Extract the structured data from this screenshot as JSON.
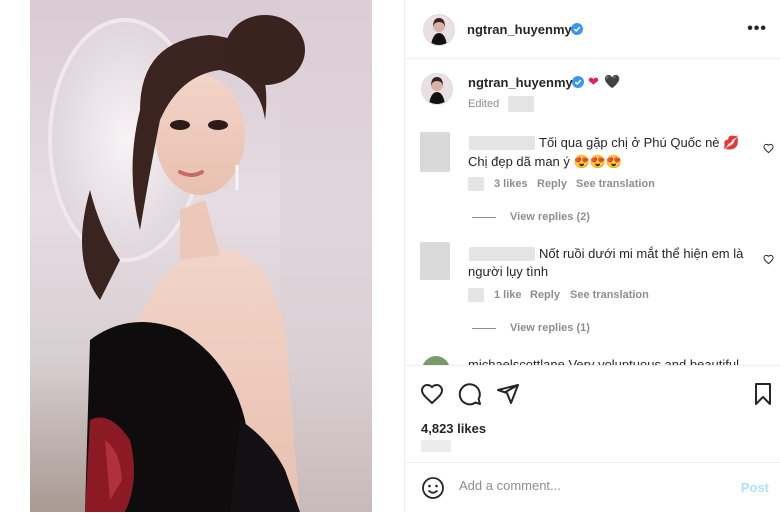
{
  "post": {
    "author": "ngtran_huyenmy",
    "caption_emojis": [
      "❤",
      "🖤"
    ],
    "edited_label": "Edited",
    "likes": "4,823 likes"
  },
  "comments": [
    {
      "line1": "Tối qua gặp chị ở Phú Quốc nè 💋",
      "line2": "Chị đẹp dã man ý 😍😍😍",
      "likes": "3 likes",
      "reply": "Reply",
      "translate": "See translation",
      "view_replies": "View replies (2)"
    },
    {
      "line1": "Nốt ruồi dưới mi mắt thể hiện em là",
      "line2": "người lụy tình",
      "likes": "1 like",
      "reply": "Reply",
      "translate": "See translation",
      "view_replies": "View replies (1)"
    }
  ],
  "partial_comment": "michaelscottlane Very voluptuous and beautiful",
  "add_comment": {
    "placeholder": "Add a comment...",
    "post_label": "Post"
  },
  "colors": {
    "verified": "#3897f0",
    "text": "#262626",
    "muted": "#8e8e8e",
    "post_disabled": "#b2dffc"
  }
}
